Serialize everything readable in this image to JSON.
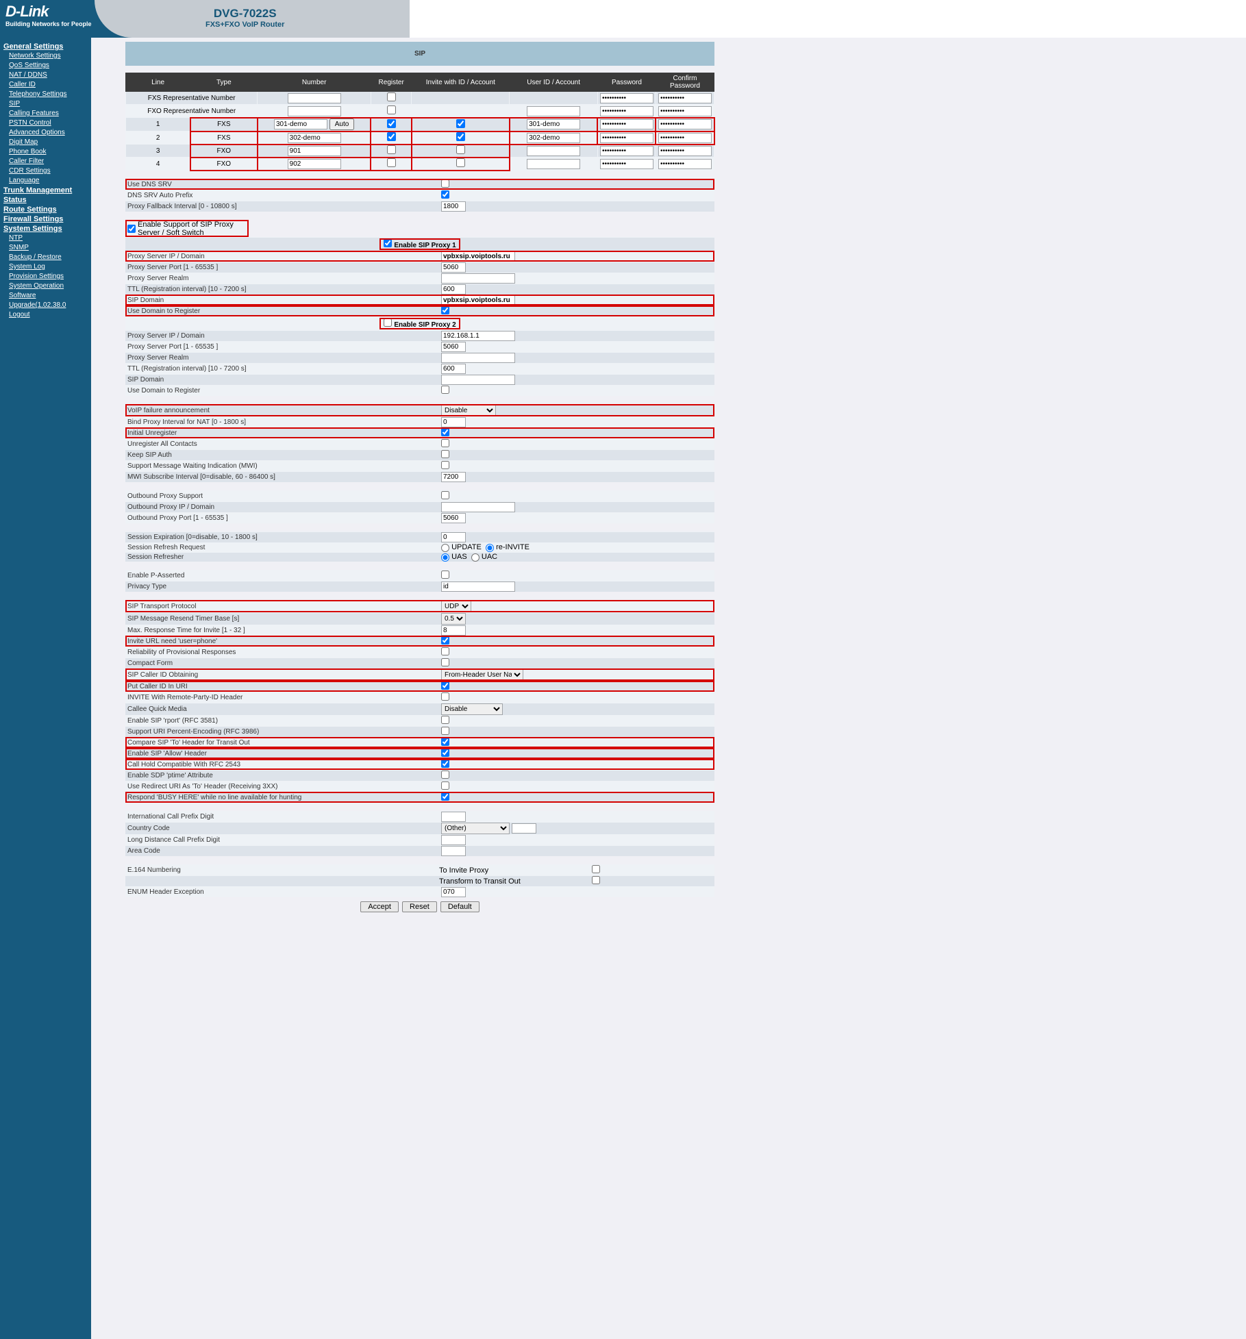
{
  "brand": "D-Link",
  "brand_tag": "Building Networks for People",
  "model": "DVG-7022S",
  "model_sub": "FXS+FXO VoIP Router",
  "page_title": "SIP",
  "nav": {
    "general": "General Settings",
    "general_items": [
      "Network Settings",
      "QoS Settings",
      "NAT / DDNS",
      "Caller ID",
      "Telephony Settings",
      "SIP",
      "Calling Features",
      "PSTN Control",
      "Advanced Options",
      "Digit Map",
      "Phone Book",
      "Caller Filter",
      "CDR Settings",
      "Language"
    ],
    "trunk": "Trunk Management",
    "status": "Status",
    "route": "Route Settings",
    "firewall": "Firewall Settings",
    "system": "System Settings",
    "system_items": [
      "NTP",
      "SNMP",
      "Backup / Restore",
      "System Log",
      "Provision Settings",
      "System Operation",
      "Software Upgrade(1.02.38.0",
      "Logout"
    ]
  },
  "table": {
    "headers": [
      "Line",
      "Type",
      "Number",
      "Register",
      "Invite with ID / Account",
      "User ID / Account",
      "Password",
      "Confirm Password"
    ],
    "fxs_rep": "FXS Representative Number",
    "fxo_rep": "FXO Representative Number",
    "auto_btn": "Auto",
    "pw_mask": "••••••••••",
    "rows": [
      {
        "line": "1",
        "type": "FXS",
        "number": "301-demo",
        "reg": true,
        "inv": true,
        "uid": "301-demo"
      },
      {
        "line": "2",
        "type": "FXS",
        "number": "302-demo",
        "reg": true,
        "inv": true,
        "uid": "302-demo"
      },
      {
        "line": "3",
        "type": "FXO",
        "number": "901",
        "reg": false,
        "inv": false,
        "uid": ""
      },
      {
        "line": "4",
        "type": "FXO",
        "number": "902",
        "reg": false,
        "inv": false,
        "uid": ""
      }
    ]
  },
  "settings": {
    "use_dns_srv": "Use DNS SRV",
    "dns_srv_auto": "DNS SRV Auto Prefix",
    "proxy_fallback": "Proxy Fallback Interval [0 - 10800 s]",
    "proxy_fallback_v": "1800",
    "enable_proxy_support": "Enable Support of SIP Proxy Server / Soft Switch",
    "enable_sip_proxy1": "Enable SIP Proxy 1",
    "proxy_ip": "Proxy Server IP / Domain",
    "proxy1_ip_v": "vpbxsip.voiptools.ru",
    "proxy_port": "Proxy Server Port [1 - 65535 ]",
    "proxy1_port_v": "5060",
    "proxy_realm": "Proxy Server Realm",
    "ttl": "TTL (Registration interval) [10 - 7200 s]",
    "proxy1_ttl_v": "600",
    "sip_domain": "SIP Domain",
    "proxy1_domain_v": "vpbxsip.voiptools.ru",
    "use_domain_reg": "Use Domain to Register",
    "enable_sip_proxy2": "Enable SIP Proxy 2",
    "proxy2_ip_v": "192.168.1.1",
    "proxy2_port_v": "5060",
    "proxy2_ttl_v": "600",
    "voip_fail": "VoIP failure announcement",
    "voip_fail_v": "Disable",
    "bind_proxy": "Bind Proxy Interval for NAT [0 - 1800 s]",
    "bind_proxy_v": "0",
    "initial_unreg": "Initial Unregister",
    "unreg_all": "Unregister All Contacts",
    "keep_sip_auth": "Keep SIP Auth",
    "mwi_support": "Support Message Waiting Indication (MWI)",
    "mwi_interval": "MWI Subscribe Interval [0=disable, 60 - 86400 s]",
    "mwi_interval_v": "7200",
    "outbound_support": "Outbound Proxy Support",
    "outbound_ip": "Outbound Proxy IP / Domain",
    "outbound_port": "Outbound Proxy Port [1 - 65535 ]",
    "outbound_port_v": "5060",
    "session_exp": "Session Expiration [0=disable, 10 - 1800 s]",
    "session_exp_v": "0",
    "session_refresh": "Session Refresh Request",
    "session_refresh_update": "UPDATE",
    "session_refresh_reinvite": "re-INVITE",
    "session_refresher": "Session Refresher",
    "session_refresher_uas": "UAS",
    "session_refresher_uac": "UAC",
    "enable_passerted": "Enable P-Asserted",
    "privacy_type": "Privacy Type",
    "privacy_type_v": "id",
    "sip_transport": "SIP Transport Protocol",
    "sip_transport_v": "UDP",
    "sip_resend": "SIP Message Resend Timer Base [s]",
    "sip_resend_v": "0.5",
    "max_response": "Max. Response Time for Invite [1 - 32 ]",
    "max_response_v": "8",
    "invite_url": "Invite URL need 'user=phone'",
    "reliability_prov": "Reliability of Provisional Responses",
    "compact_form": "Compact Form",
    "sip_caller_obtain": "SIP Caller ID Obtaining",
    "sip_caller_obtain_v": "From-Header User Name",
    "put_caller_uri": "Put Caller ID In URI",
    "invite_rpid": "INVITE With Remote-Party-ID Header",
    "callee_quick": "Callee Quick Media",
    "callee_quick_v": "Disable",
    "enable_rport": "Enable SIP 'rport' (RFC 3581)",
    "support_uri_pct": "Support URI Percent-Encoding (RFC 3986)",
    "compare_to": "Compare SIP 'To' Header for Transit Out",
    "enable_allow": "Enable SIP 'Allow' Header",
    "call_hold_2543": "Call Hold Compatible With RFC 2543",
    "enable_sdp_ptime": "Enable SDP 'ptime' Attribute",
    "use_redirect_uri": "Use Redirect URI As 'To' Header (Receiving 3XX)",
    "respond_busy": "Respond 'BUSY HERE' while no line available for hunting",
    "intl_prefix": "International Call Prefix Digit",
    "country_code": "Country Code",
    "country_code_v": "(Other)",
    "long_dist": "Long Distance Call Prefix Digit",
    "area_code": "Area Code",
    "e164": "E.164 Numbering",
    "to_invite_proxy": "To Invite Proxy",
    "transform_transit": "Transform to Transit Out",
    "enum_header": "ENUM Header Exception",
    "enum_header_v": "070"
  },
  "buttons": {
    "accept": "Accept",
    "reset": "Reset",
    "default": "Default"
  }
}
